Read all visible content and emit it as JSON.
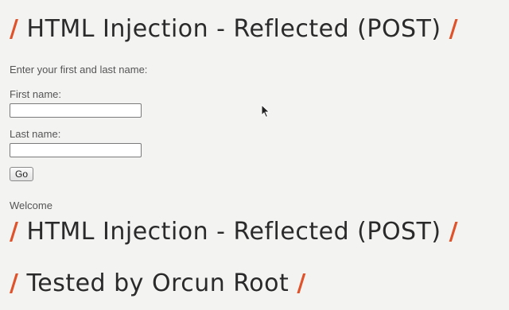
{
  "heading": {
    "prefix": "/",
    "title": "HTML Injection - Reflected (POST)",
    "suffix": "/"
  },
  "form": {
    "intro": "Enter your first and last name:",
    "first_name_label": "First name:",
    "first_name_value": "",
    "last_name_label": "Last name:",
    "last_name_value": "",
    "go_label": "Go"
  },
  "result": {
    "welcome": "Welcome",
    "reflected_heading": {
      "prefix": "/",
      "title": "HTML Injection - Reflected (POST)",
      "suffix": "/"
    },
    "tested_heading": {
      "prefix": "/",
      "title": "Tested by Orcun Root",
      "suffix": "/"
    }
  },
  "colors": {
    "accent": "#e0522a",
    "heading_text": "#2a2a2a",
    "background": "#f3f3f2"
  }
}
